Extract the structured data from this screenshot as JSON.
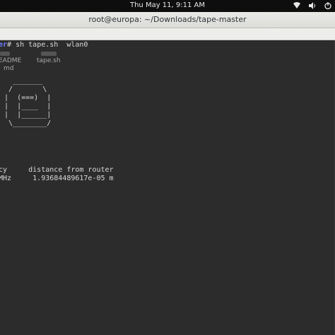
{
  "topbar": {
    "clock": "Thu May 11,  9:11 AM",
    "icons": [
      "network-icon",
      "volume-icon",
      "power-icon"
    ]
  },
  "window": {
    "title": "root@europa: ~/Downloads/tape-master"
  },
  "terminal": {
    "prompt_user": "er",
    "prompt_symbol": "# ",
    "command": "sh tape.sh  wlan0",
    "background_files": [
      {
        "label": "EADME",
        "sub": "md"
      },
      {
        "label": "tape.sh",
        "sub": ""
      }
    ],
    "ascii_art": "   _______\n  /       \\\n |  (===)  |\n |  |____  |\n |  |______|\n  \\________/",
    "table_header": "cy     distance from router",
    "table_row": "MHz     1.93684489617e-05 m"
  },
  "colors": {
    "terminal_bg": "#2c2c2c",
    "prompt_user": "#6a7cff",
    "titlebar": "#e4e4e2"
  }
}
